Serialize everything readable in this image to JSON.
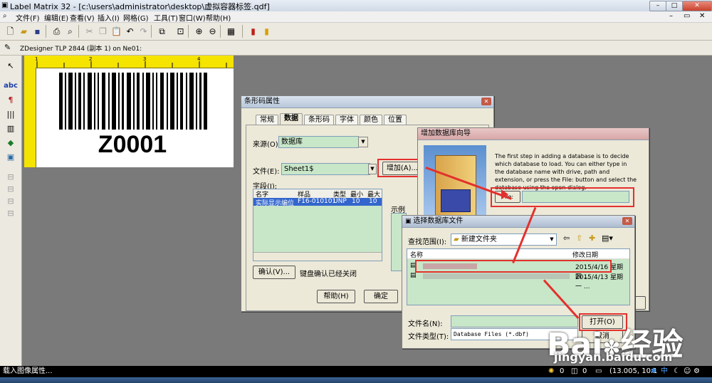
{
  "window": {
    "title": "Label Matrix 32 - [c:\\users\\administrator\\desktop\\虚拟容器标签.qdf]"
  },
  "menu": [
    "文件(F)",
    "编辑(E)",
    "查看(V)",
    "插入(I)",
    "网格(G)",
    "工具(T)",
    "窗口(W)",
    "帮助(H)"
  ],
  "printer": {
    "label": "ZDesigner TLP 2844 (副本 1) on Ne01:"
  },
  "label": {
    "barcode_text": "Z0001"
  },
  "barcode_dialog": {
    "title": "条形码属性",
    "tabs": [
      "常规",
      "数据",
      "条形码",
      "字体",
      "颜色",
      "位置"
    ],
    "source_label": "来源(O):",
    "source_value": "数据库",
    "file_label": "文件(E):",
    "file_value": "Sheet1$",
    "add_button": "增加(A)...",
    "fields_label": "字段(I):",
    "columns": [
      "名字",
      "样品",
      "类型",
      "最小",
      "最大"
    ],
    "rows": [
      [
        "实际显示编位",
        "F16-010101",
        "UNP",
        "10",
        "10"
      ]
    ],
    "example_label": "示例",
    "confirm_button": "确认(V)...",
    "confirm_text": "键盘确认已经关闭",
    "help_button": "帮助(H)",
    "ok_button": "确定"
  },
  "wizard_dialog": {
    "title": "增加数据库向导",
    "description": "The first step in adding a database is to decide which database to load.  You can either type in the database name with drive, path and extension, or press the File: button and select the database using the open dialog.",
    "file_button": "File:"
  },
  "open_dialog": {
    "title": "选择数据库文件",
    "look_in_label": "查找范围(I):",
    "look_in_value": "新建文件夹",
    "col_name": "名称",
    "col_date": "修改日期",
    "files": [
      {
        "date": "2015/4/16 星期四 ..."
      },
      {
        "date": "2015/4/13 星期一 ..."
      }
    ],
    "filename_label": "文件名(N):",
    "filetype_label": "文件类型(T):",
    "filetype_value": "Database Files (*.dbf)",
    "open_button": "打开(O)",
    "cancel_button": "取消"
  },
  "status": {
    "text": "载入图像属性...",
    "val1": "0",
    "val2": "0",
    "coords": "(13.005, 10.1",
    "ime": "中"
  },
  "watermark": {
    "brand": "Bai",
    "brand2": "经验",
    "url": "jingyan.baidu.com"
  },
  "colors": {
    "accent_red": "#e3302d",
    "ruler_yellow": "#f5e300",
    "list_green": "#c8e6c8"
  }
}
